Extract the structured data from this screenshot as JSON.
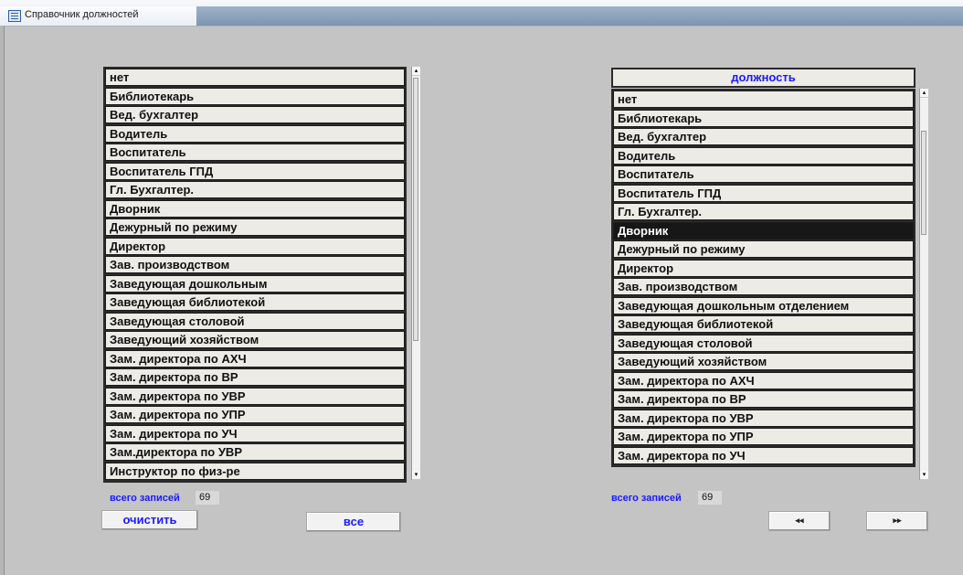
{
  "window": {
    "title": "Справочник должностей"
  },
  "left_list": {
    "items": [
      "нет",
      "Библиотекарь",
      "Вед. бухгалтер",
      "Водитель",
      "Воспитатель",
      "Воспитатель ГПД",
      "Гл. Бухгалтер.",
      "Дворник",
      "Дежурный по режиму",
      "Директор",
      "Зав. производством",
      "Заведующая  дошкольным",
      "Заведующая библиотекой",
      "Заведующая столовой",
      "Заведующий хозяйством",
      "Зам. директора по АХЧ",
      "Зам. директора по ВР",
      "Зам. директора по УВР",
      "Зам. директора по УПР",
      "Зам. директора по УЧ",
      "Зам.директора по УВР",
      "Инструктор по физ-ре"
    ],
    "count_label": "всего записей",
    "count_value": "69",
    "clear_button": "очистить",
    "all_button": "все"
  },
  "right_list": {
    "header": "должность",
    "selected": "Дворник",
    "items": [
      "нет",
      "Библиотекарь",
      "Вед. бухгалтер",
      "Водитель",
      "Воспитатель",
      "Воспитатель ГПД",
      "Гл. Бухгалтер.",
      "Дворник",
      "Дежурный по режиму",
      "Директор",
      "Зав. производством",
      "Заведующая  дошкольным отделением",
      "Заведующая библиотекой",
      "Заведующая столовой",
      "Заведующий хозяйством",
      "Зам. директора по АХЧ",
      "Зам. директора по ВР",
      "Зам. директора по УВР",
      "Зам. директора по УПР",
      "Зам. директора по УЧ"
    ],
    "count_label": "всего записей",
    "count_value": "69",
    "prev_button": "◂◂",
    "next_button": "▸▸"
  }
}
